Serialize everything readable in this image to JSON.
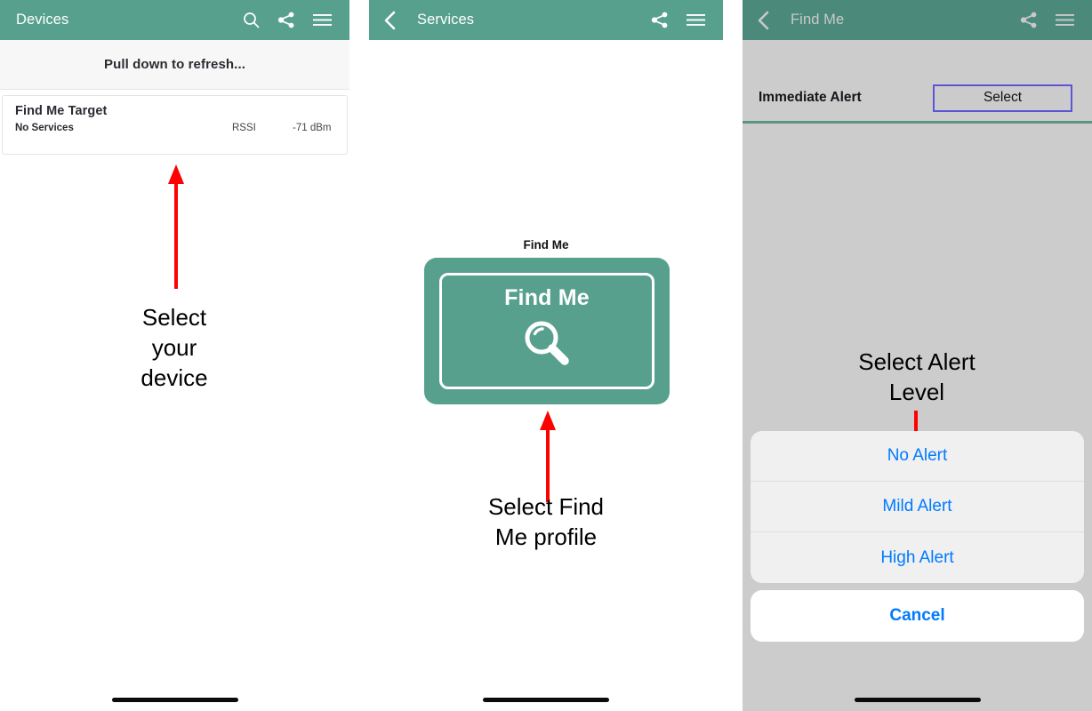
{
  "panels": {
    "devices": {
      "nav": {
        "title": "Devices",
        "icons": [
          "search-icon",
          "share-icon",
          "menu-icon"
        ]
      },
      "refresh_text": "Pull down to refresh...",
      "device": {
        "name": "Find Me Target",
        "services": "No Services",
        "rssi_label": "RSSI",
        "rssi_value": "-71 dBm"
      },
      "annotation": "Select\nyour\ndevice"
    },
    "services": {
      "nav": {
        "title": "Services",
        "back": "back-chevron-icon",
        "icons": [
          "share-icon",
          "menu-icon"
        ]
      },
      "tile_caption": "Find Me",
      "tile_label": "Find Me",
      "tile_icon": "magnifier-icon",
      "annotation": "Select Find\nMe profile"
    },
    "findme": {
      "nav": {
        "title": "Find Me",
        "back": "back-chevron-icon",
        "icons": [
          "share-icon",
          "menu-icon"
        ]
      },
      "alert_row": {
        "label": "Immediate Alert",
        "select_button": "Select"
      },
      "annotation": "Select Alert\nLevel",
      "action_sheet": {
        "options": [
          "No Alert",
          "Mild Alert",
          "High Alert"
        ],
        "cancel": "Cancel"
      }
    }
  },
  "colors": {
    "nav_green": "#57a08d",
    "nav_green_dim": "#4b8a7a",
    "arrow_red": "#ff0000",
    "sheet_blue": "#007aff",
    "select_border": "#5b56d6",
    "overlay_grey": "#cccccc"
  }
}
